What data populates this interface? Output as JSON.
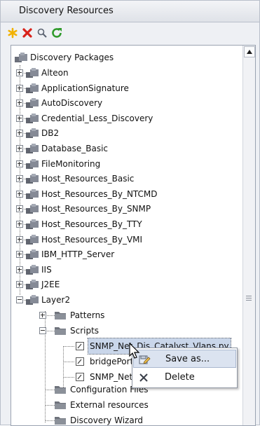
{
  "panel": {
    "title": "Discovery Resources"
  },
  "toolbar": {
    "buttons": [
      {
        "name": "new",
        "icon": "asterisk-icon",
        "color": "#f2b200"
      },
      {
        "name": "delete",
        "icon": "red-x-icon",
        "color": "#d8221a"
      },
      {
        "name": "search",
        "icon": "magnifier-icon",
        "color": "#5a6270"
      },
      {
        "name": "refresh",
        "icon": "green-refresh-icon",
        "color": "#2f9a2b"
      }
    ]
  },
  "tree": {
    "root": "Discovery Packages",
    "packages": [
      "Alteon",
      "ApplicationSignature",
      "AutoDiscovery",
      "Credential_Less_Discovery",
      "DB2",
      "Database_Basic",
      "FileMonitoring",
      "Host_Resources_Basic",
      "Host_Resources_By_NTCMD",
      "Host_Resources_By_SNMP",
      "Host_Resources_By_TTY",
      "Host_Resources_By_VMI",
      "IBM_HTTP_Server",
      "IIS",
      "J2EE",
      "Layer2"
    ],
    "layer2_children": [
      "Patterns",
      "Scripts",
      "Configuration Files",
      "External resources",
      "Discovery Wizard"
    ],
    "scripts": [
      "SNMP_Net_Dis_Catalyst_Vlans.py",
      "bridgePortDisc.py",
      "SNMP_Net_Dis_VMware.py"
    ]
  },
  "context_menu": {
    "items": [
      {
        "label": "Save as...",
        "icon": "save-as-icon"
      },
      {
        "label": "Delete",
        "icon": "delete-x-icon"
      }
    ]
  }
}
